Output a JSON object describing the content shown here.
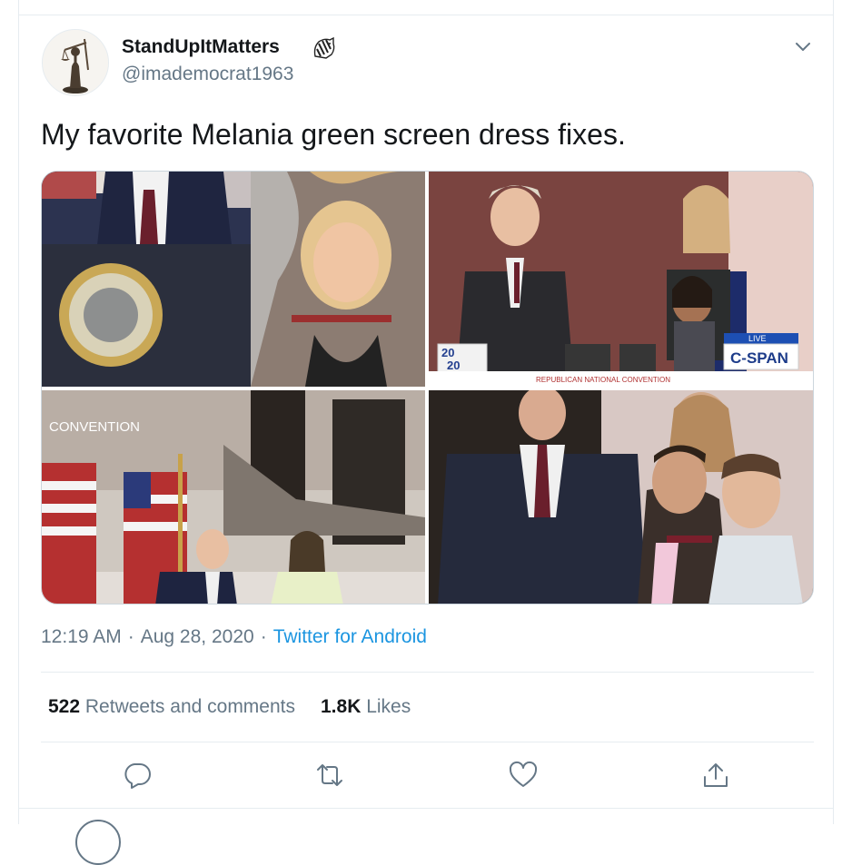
{
  "user": {
    "name": "StandUpItMatters",
    "handle": "@imademocrat1963",
    "avatar_icon": "lady-justice-statue",
    "badge_icon": "zebra-emoji-icon"
  },
  "tweet": {
    "text": "My favorite Melania green screen dress fixes.",
    "photos": [
      {
        "caption": ""
      },
      {
        "caption_2020": "20",
        "caption_2020b": "20",
        "live": "LIVE",
        "network": "C-SPAN",
        "banner": "REPUBLICAN NATIONAL CONVENTION"
      },
      {
        "overlay": "CONVENTION"
      },
      {
        "caption": ""
      }
    ]
  },
  "meta": {
    "time": "12:19 AM",
    "separator": "·",
    "date": "Aug 28, 2020",
    "source": "Twitter for Android"
  },
  "stats": {
    "retweets_count": "522",
    "retweets_label": "Retweets and comments",
    "likes_count": "1.8K",
    "likes_label": "Likes"
  },
  "actions": [
    {
      "name": "reply",
      "icon": "reply-icon"
    },
    {
      "name": "retweet",
      "icon": "retweet-icon"
    },
    {
      "name": "like",
      "icon": "heart-icon"
    },
    {
      "name": "share",
      "icon": "share-icon"
    }
  ],
  "colors": {
    "link": "#1b95e0",
    "secondary_text": "#657786",
    "primary_text": "#14171a",
    "border": "#e6ecf0"
  }
}
